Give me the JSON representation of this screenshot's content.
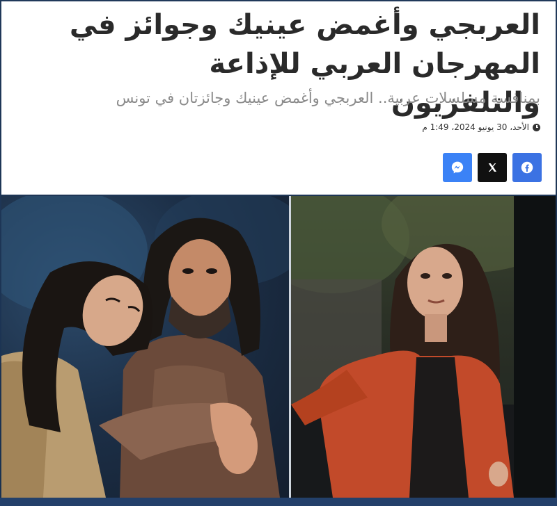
{
  "article": {
    "headline": "العربجي وأغمض عينيك وجوائز في المهرجان العربي للإذاعة والتلفزيون",
    "subtitle": "بمنافسة مسلسلات عربية.. العربجي وأغمض عينيك وجائزتان في تونس",
    "date": "الأحد، 30 يونيو 2024، 1:49 م"
  },
  "share": {
    "buttons": [
      {
        "name": "facebook",
        "icon": "facebook-icon",
        "color": "#3b72e3"
      },
      {
        "name": "x",
        "icon": "x-icon",
        "color": "#111111"
      },
      {
        "name": "messenger",
        "icon": "messenger-icon",
        "color": "#3b82f6"
      }
    ]
  },
  "photos": {
    "left": "drama-still-couple",
    "right": "drama-still-woman"
  },
  "colors": {
    "background": "#1f3756",
    "headline": "#2a2a2a",
    "subtitle": "#8a8a8a"
  }
}
